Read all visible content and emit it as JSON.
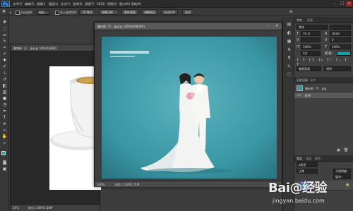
{
  "app": {
    "logo": "Ps"
  },
  "menu": [
    "文件(F)",
    "编辑(E)",
    "图像(I)",
    "图层(L)",
    "文字(Y)",
    "选择(S)",
    "滤镜(T)",
    "3D(D)",
    "视图(V)",
    "窗口(W)",
    "帮助(H)"
  ],
  "options": {
    "auto_select": "自动选择:",
    "auto_select_value": "图层",
    "show_transform": "显示变换控件",
    "align_btn_1": "3D 模式",
    "btn_a": "调整边缘...",
    "btn_b": "删除通道",
    "btn_c": "调整图层",
    "btn_d": "自动对齐"
  },
  "doc_back": {
    "tab": "咖啡杯（1）.jpg @ 50%(RGB/8)",
    "zoom": "50%",
    "status": "文档:1.86M/1.86M"
  },
  "doc_front": {
    "tab": "婚纱照（7）.jpg @ 100%(RGB/8#)",
    "zoom": "100%",
    "status": "文档:1.11M/1.11M"
  },
  "panels": {
    "character_tab": "字符",
    "paragraph_tab": "段落",
    "font_family": "黑体",
    "font_size": "16 点",
    "leading": "(自动)",
    "tracking": "0",
    "scale_v": "100%",
    "scale_h": "100%",
    "history_tab": "历史记录",
    "actions_tab": "动作",
    "history_items": [
      "婚纱照（7）.jpg",
      "打开"
    ],
    "layers_tab": "图层",
    "channels_tab": "通道",
    "paths_tab": "路径",
    "layer_name": "背景"
  },
  "watermark": {
    "brand": "Bai@经验",
    "url": "jingyan.baidu.com"
  },
  "colors": {
    "accent": "#2d7fb5",
    "canvas_teal": "#3a96a3",
    "menu_bg": "#2b2b2b"
  }
}
